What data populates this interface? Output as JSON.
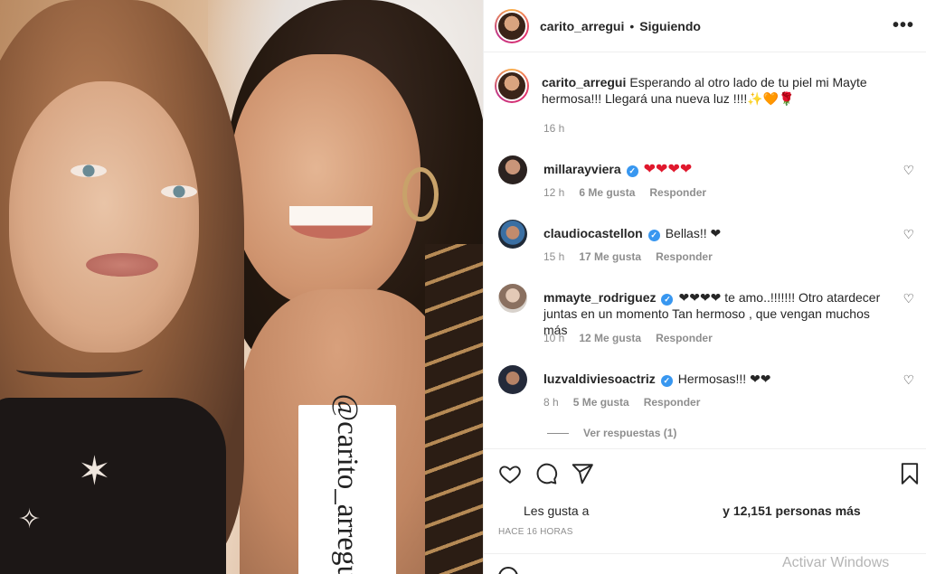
{
  "post": {
    "tag_text": "@carito_arregui",
    "header": {
      "username": "carito_arregui",
      "separator": "•",
      "follow_status": "Siguiendo",
      "more_label": "•••"
    },
    "caption": {
      "username": "carito_arregui",
      "text": "Esperando al otro lado de tu piel mi Mayte hermosa!!! Llegará una nueva luz !!!!✨🧡🌹",
      "time": "16 h"
    },
    "comments": [
      {
        "username": "millarayviera",
        "verified": true,
        "text": "❤❤❤❤",
        "time": "12 h",
        "likes": "6 Me gusta",
        "reply": "Responder"
      },
      {
        "username": "claudiocastellon",
        "verified": true,
        "text": "Bellas!! ❤",
        "time": "15 h",
        "likes": "17 Me gusta",
        "reply": "Responder"
      },
      {
        "username": "mmayte_rodriguez",
        "verified": true,
        "text": "❤❤❤❤ te amo..!!!!!!! Otro atardecer juntas en un momento Tan hermoso , que vengan muchos más",
        "time": "10 h",
        "likes": "12 Me gusta",
        "reply": "Responder"
      },
      {
        "username": "luzvaldiviesoactriz",
        "verified": true,
        "text": "Hermosas!!! ❤❤",
        "time": "8 h",
        "likes": "5 Me gusta",
        "reply": "Responder"
      }
    ],
    "view_replies": "Ver respuestas (1)",
    "likes_prefix": "Les gusta a",
    "likes_suffix": "y 12,151 personas más",
    "timestamp": "HACE 16 HORAS",
    "watermark": "Activar Windows"
  }
}
